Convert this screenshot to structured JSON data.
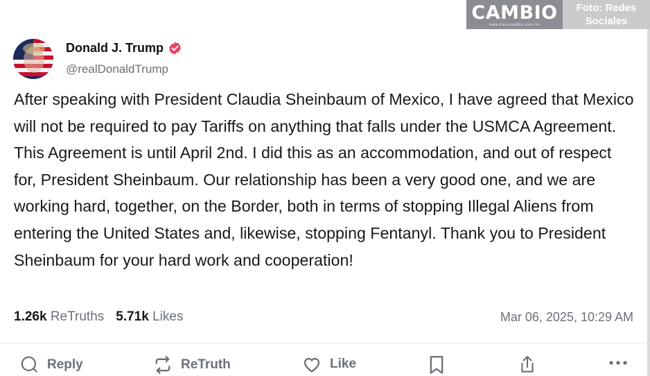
{
  "watermark": {
    "brand": "CAMBIO",
    "brand_small": "www.diariocambio.com.mx",
    "credit_line1": "Foto: Redes",
    "credit_line2": "Sociales"
  },
  "post": {
    "author_name": "Donald J. Trump",
    "author_handle": "@realDonaldTrump",
    "text": "After speaking with President Claudia Sheinbaum of Mexico, I have agreed that Mexico will not be required to pay Tariffs on anything that falls under the USMCA Agreement. This Agreement is until April 2nd. I did this as an accommodation, and out of respect for, President Sheinbaum. Our relationship has been a very good one, and we are working hard, together, on the Border, both in terms of stopping Illegal Aliens from entering the United States and, likewise, stopping Fentanyl. Thank you to President Sheinbaum for your hard work and cooperation!",
    "retruths_count": "1.26k",
    "retruths_label": "ReTruths",
    "likes_count": "5.71k",
    "likes_label": "Likes",
    "timestamp": "Mar 06, 2025, 10:29 AM"
  },
  "actions": {
    "reply": "Reply",
    "retruth": "ReTruth",
    "like": "Like"
  },
  "colors": {
    "verified_badge": "#e9425e",
    "muted_text": "#6b7078"
  },
  "icons": [
    "avatar",
    "verified-badge-icon",
    "reply-icon",
    "retruth-icon",
    "like-icon",
    "bookmark-icon",
    "share-icon",
    "more-icon"
  ]
}
